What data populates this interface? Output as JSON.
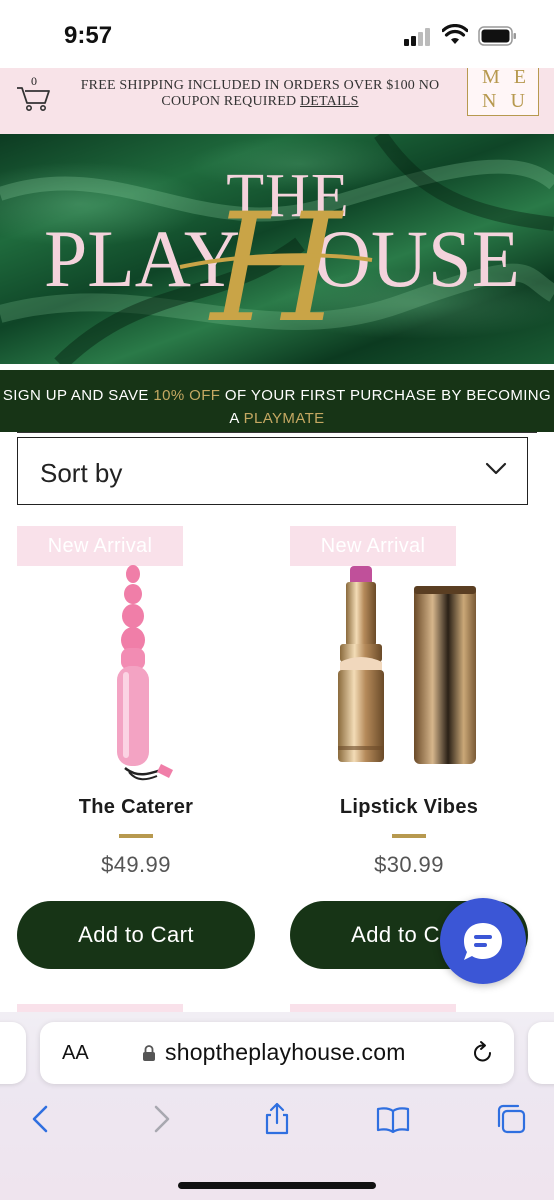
{
  "status_bar": {
    "time": "9:57"
  },
  "header": {
    "cart_count": "0",
    "shipping_text": "FREE  SHIPPING INCLUDED IN ORDERS OVER $100 NO COUPON REQUIRED",
    "details_link": "DETAILS",
    "menu_line1": "ME",
    "menu_line2": "NU"
  },
  "hero": {
    "logo_line1": "THE",
    "logo_line2_left": "PLAY",
    "logo_line2_right": "OUSE",
    "logo_script_letter": "H"
  },
  "signup_banner": {
    "text_1": "SIGN UP AND SAVE ",
    "highlight_1": "10% OFF",
    "text_2": " OF YOUR FIRST PURCHASE BY BECOMING A ",
    "highlight_2": "PLAYMATE"
  },
  "sort": {
    "label": "Sort by"
  },
  "products": [
    {
      "badge": "New Arrival",
      "name": "The Caterer",
      "price": "$49.99",
      "button": "Add to Cart"
    },
    {
      "badge": "New Arrival",
      "name": "Lipstick Vibes",
      "price": "$30.99",
      "button": "Add to Cart"
    }
  ],
  "browser": {
    "aa_label": "AA",
    "url": "shoptheplayhouse.com"
  },
  "colors": {
    "brand_green": "#173416",
    "gold": "#b7994f",
    "pink": "#f8e3e8",
    "chat_blue": "#3b56d6"
  },
  "icons": [
    "cart-icon",
    "chevron-down-icon",
    "chat-icon",
    "lock-icon",
    "reload-icon",
    "back-icon",
    "forward-icon",
    "share-icon",
    "bookmarks-icon",
    "tabs-icon"
  ]
}
